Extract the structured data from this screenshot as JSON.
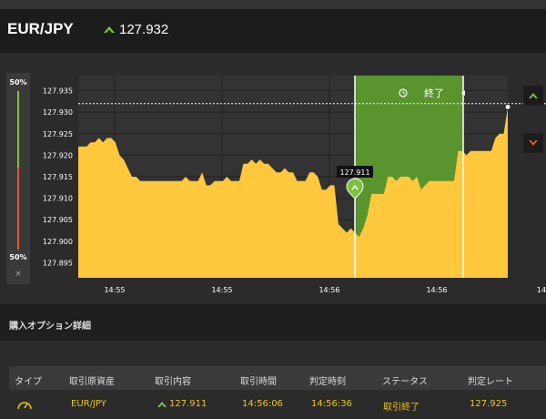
{
  "header": {
    "pair": "EUR/JPY",
    "price": "127.932",
    "up_color": "#7dc142"
  },
  "gauge": {
    "top_label": "50%",
    "bottom_label": "50%",
    "close_glyph": "×"
  },
  "chart_data": {
    "type": "area",
    "y_ticks": [
      "127.935",
      "127.930",
      "127.925",
      "127.920",
      "127.915",
      "127.910",
      "127.905",
      "127.900",
      "127.895"
    ],
    "ylim": [
      127.8915,
      127.9385
    ],
    "x_ticks": [
      "14:55",
      "14:55",
      "14:56",
      "14:56",
      "14"
    ],
    "series": [
      {
        "values": [
          127.922,
          127.922,
          127.922,
          127.923,
          127.923,
          127.924,
          127.923,
          127.924,
          127.924,
          127.923,
          127.92,
          127.919,
          127.917,
          127.915,
          127.915,
          127.914,
          127.914,
          127.914,
          127.914,
          127.914,
          127.914,
          127.914,
          127.914,
          127.914,
          127.914,
          127.914,
          127.915,
          127.914,
          127.914,
          127.914,
          127.916,
          127.913,
          127.913,
          127.914,
          127.914,
          127.914,
          127.915,
          127.914,
          127.914,
          127.914,
          127.918,
          127.918,
          127.919,
          127.918,
          127.919,
          127.918,
          127.918,
          127.917,
          127.916,
          127.916,
          127.917,
          127.916,
          127.916,
          127.914,
          127.914,
          127.914,
          127.916,
          127.916,
          127.915,
          127.912,
          127.912,
          127.913,
          127.913,
          127.904,
          127.903,
          127.902,
          127.903,
          127.902,
          127.901,
          127.903,
          127.906,
          127.911,
          127.911,
          127.911,
          127.911,
          127.915,
          127.915,
          127.914,
          127.915,
          127.915,
          127.915,
          127.914,
          127.915,
          127.912,
          127.913,
          127.914,
          127.914,
          127.914,
          127.914,
          127.914,
          127.914,
          127.914,
          127.921,
          127.921,
          127.92,
          127.921,
          127.921,
          127.921,
          127.921,
          127.921,
          127.921,
          127.924,
          127.925,
          127.925,
          127.931
        ]
      }
    ],
    "current_price": 127.932,
    "entry": {
      "label": "127.911",
      "value": 127.911
    },
    "expiry_label": "終了",
    "area_color": "#ffc83d",
    "window_color": "#5c9a2e"
  },
  "section": {
    "title": "購入オプション詳細"
  },
  "table": {
    "headers": [
      "タイプ",
      "取引原資産",
      "取引内容",
      "取引時間",
      "判定時刻",
      "ステータス",
      "判定レート"
    ],
    "row": {
      "asset": "EUR/JPY",
      "content": "127.911",
      "trade_time": "14:56:06",
      "judge_time": "14:56:36",
      "status": "取引終了",
      "rate": "127.925"
    },
    "accent": "#f0c419"
  }
}
